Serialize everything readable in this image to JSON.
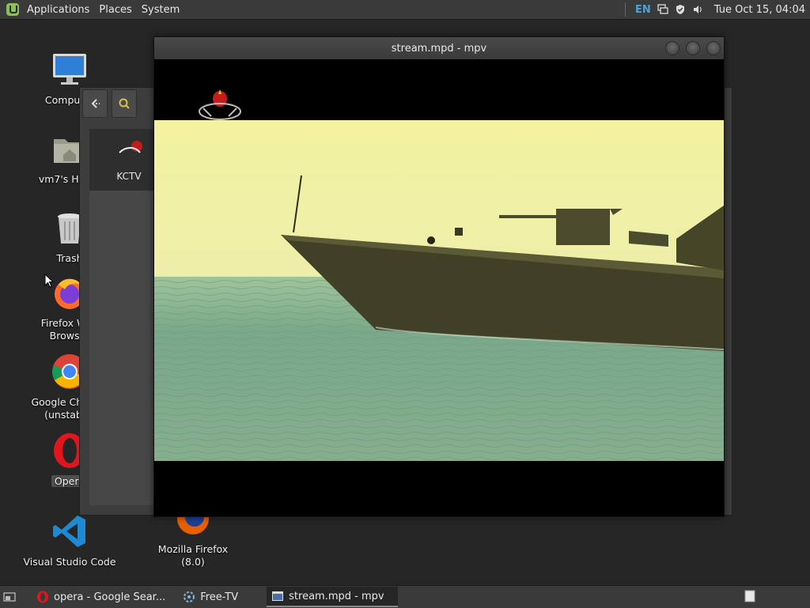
{
  "top_panel": {
    "menu": [
      "Applications",
      "Places",
      "System"
    ],
    "tray": {
      "language": "EN",
      "clock": "Tue Oct 15, 04:04"
    }
  },
  "desktop": {
    "icons": [
      {
        "label": "Computer",
        "icon": "monitor-icon"
      },
      {
        "label": "vm7's Home",
        "icon": "home-folder-icon"
      },
      {
        "label": "Trash",
        "icon": "trash-icon"
      },
      {
        "label": "Firefox Web Browser",
        "icon": "firefox-icon"
      },
      {
        "label": "Google Chrome",
        "label2": "(unstable)",
        "icon": "chrome-icon"
      },
      {
        "label": "Opera",
        "icon": "opera-icon"
      },
      {
        "label": "Visual Studio Code",
        "icon": "vscode-icon"
      },
      {
        "label": "Mozilla Firefox (8.0)",
        "icon": "firefox-old-icon"
      }
    ]
  },
  "bg_window": {
    "list_item_label": "KCTV"
  },
  "mpv": {
    "title": "stream.mpd - mpv"
  },
  "taskbar": {
    "tasks": [
      {
        "label": "opera - Google Sear...",
        "icon": "opera-icon",
        "active": false
      },
      {
        "label": "Free-TV",
        "icon": "freetv-icon",
        "active": false
      },
      {
        "label": "stream.mpd - mpv",
        "icon": "window-icon",
        "active": true
      }
    ]
  },
  "colors": {
    "panel": "#3a3a3a",
    "desktop": "#262626",
    "sky": "#f2f2a0",
    "sea": "#7aa88a",
    "ship": "#3f4026"
  }
}
